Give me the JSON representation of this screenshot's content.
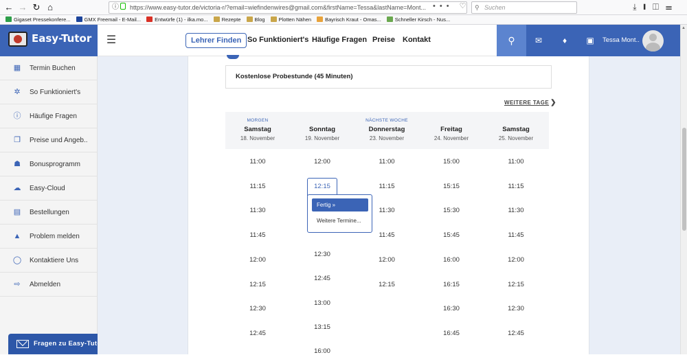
{
  "browser": {
    "url": "https://www.easy-tutor.de/victoria-r/?email=wiefindenwires@gmail.com&firstName=Tessa&lastName=Mont...",
    "search_placeholder": "Suchen",
    "url_actions": "••• ♡ ☆",
    "bookmarks": [
      {
        "label": "Gigaset Pressekonfere...",
        "color": "#2e9f4a"
      },
      {
        "label": "GMX Freemail - E-Mail...",
        "color": "#1c449b"
      },
      {
        "label": "Entwürfe (1) - ilka.mo...",
        "color": "#d93025"
      },
      {
        "label": "Rezepte",
        "color": "#c9a64a"
      },
      {
        "label": "Blog",
        "color": "#c9a64a"
      },
      {
        "label": "Plotten Nähen",
        "color": "#c9a64a"
      },
      {
        "label": "Bayrisch Kraut - Omas...",
        "color": "#e8a33b"
      },
      {
        "label": "Schneller Kirsch - Nus...",
        "color": "#6aa84f"
      }
    ]
  },
  "app": {
    "logo": "Easy-Tutor",
    "nav": [
      {
        "label": "Lehrer Finden",
        "active": true
      },
      {
        "label": "So Funktioniert's"
      },
      {
        "label": "Häufige Fragen"
      },
      {
        "label": "Preise"
      },
      {
        "label": "Kontakt"
      }
    ],
    "user_name": "Tessa Mont..",
    "accent": "#3b64b6"
  },
  "sidebar": {
    "items": [
      {
        "label": "Termin Buchen",
        "icon": "calendar-icon"
      },
      {
        "label": "So Funktioniert's",
        "icon": "lightbulb-icon"
      },
      {
        "label": "Häufige Fragen",
        "icon": "question-icon"
      },
      {
        "label": "Preise und Angeb..",
        "icon": "tag-icon"
      },
      {
        "label": "Bonusprogramm",
        "icon": "gift-icon"
      },
      {
        "label": "Easy-Cloud",
        "icon": "cloud-icon"
      },
      {
        "label": "Bestellungen",
        "icon": "id-card-icon"
      },
      {
        "label": "Problem melden",
        "icon": "warning-icon"
      },
      {
        "label": "Kontaktiere Uns",
        "icon": "whatsapp-icon"
      },
      {
        "label": "Abmelden",
        "icon": "logout-icon"
      }
    ],
    "help_button": "Fragen zu Easy-Tutor?"
  },
  "booking": {
    "lesson": "Kostenlose Probestunde (45 Minuten)",
    "more_days": "WEITERE TAGE",
    "days": [
      {
        "tag": "MORGEN",
        "name": "Samstag",
        "date": "18. November",
        "slots": [
          "11:00",
          "11:15",
          "11:30",
          "11:45",
          "12:00",
          "12:15",
          "12:30",
          "12:45"
        ]
      },
      {
        "tag": "",
        "name": "Sonntag",
        "date": "19. November",
        "slots": [
          "12:00",
          "12:15",
          "12:30",
          "12:45",
          "13:00",
          "13:15",
          "16:00"
        ]
      },
      {
        "tag": "NÄCHSTE WOCHE",
        "name": "Donnerstag",
        "date": "23. November",
        "slots": [
          "11:00",
          "11:15",
          "11:30",
          "11:45",
          "12:00",
          "12:15"
        ]
      },
      {
        "tag": "",
        "name": "Freitag",
        "date": "24. November",
        "slots": [
          "15:00",
          "15:15",
          "15:30",
          "15:45",
          "16:00",
          "16:15",
          "16:30",
          "16:45"
        ]
      },
      {
        "tag": "",
        "name": "Samstag",
        "date": "25. November",
        "slots": [
          "11:00",
          "11:15",
          "11:30",
          "11:45",
          "12:00",
          "12:15",
          "12:30",
          "12:45"
        ]
      }
    ],
    "popup": {
      "done": "Fertig »",
      "more": "Weitere Termine..."
    }
  }
}
